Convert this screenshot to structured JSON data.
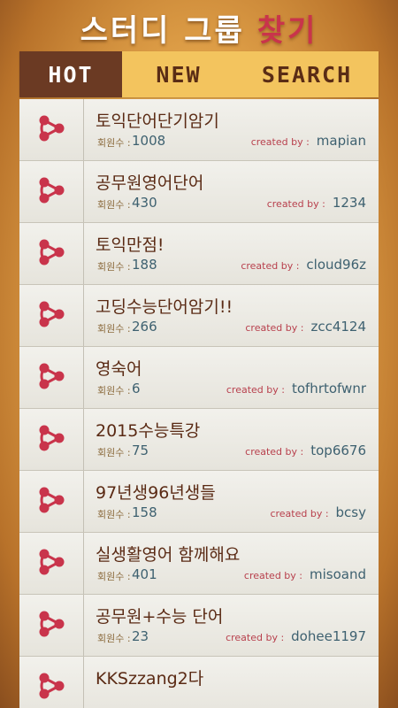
{
  "header": {
    "title_main": "스터디 그룹",
    "title_accent": "찾기"
  },
  "tabs": [
    {
      "label": "HOT",
      "active": true
    },
    {
      "label": "NEW",
      "active": false
    },
    {
      "label": "SEARCH",
      "active": false
    }
  ],
  "colors": {
    "accent": "#c9344b",
    "icon": "#c9344b",
    "active_tab": "#6b3a23",
    "tab_bg": "#f3c45e"
  },
  "labels": {
    "members": "회원수 :",
    "created_by": "created by :"
  },
  "groups": [
    {
      "title": "토익단어단기암기",
      "members": "1008",
      "creator": "mapian",
      "icon": "share-icon"
    },
    {
      "title": "공무원영어단어",
      "members": "430",
      "creator": "1234",
      "icon": "share-icon"
    },
    {
      "title": "토익만점!",
      "members": "188",
      "creator": "cloud96z",
      "icon": "share-icon"
    },
    {
      "title": "고딩수능단어암기!!",
      "members": "266",
      "creator": "zcc4124",
      "icon": "share-icon"
    },
    {
      "title": "영숙어",
      "members": "6",
      "creator": "tofhrtofwnr",
      "icon": "share-icon"
    },
    {
      "title": "2015수능특강",
      "members": "75",
      "creator": "top6676",
      "icon": "share-icon"
    },
    {
      "title": "97년생96년생들",
      "members": "158",
      "creator": "bcsy",
      "icon": "share-icon"
    },
    {
      "title": "실생활영어 함께해요",
      "members": "401",
      "creator": "misoand",
      "icon": "share-icon"
    },
    {
      "title": "공무원+수능 단어",
      "members": "23",
      "creator": "dohee1197",
      "icon": "share-icon"
    },
    {
      "title": "KKSzzang2다",
      "members": "",
      "creator": "",
      "icon": "share-icon"
    }
  ]
}
